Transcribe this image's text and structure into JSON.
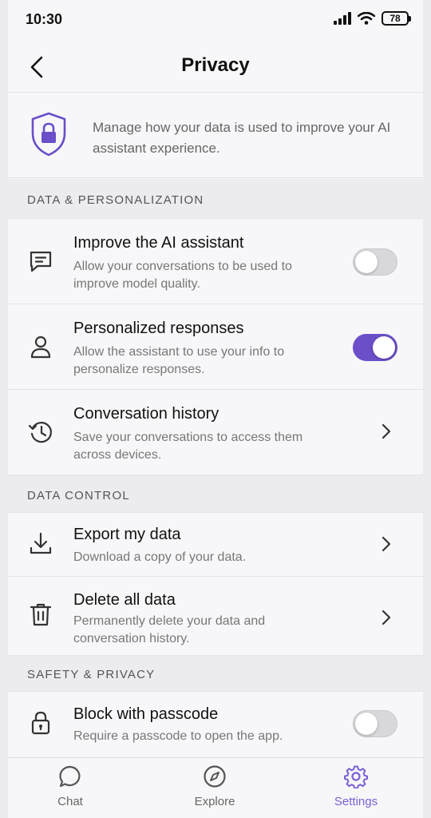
{
  "status_bar": {
    "time": "10:30",
    "battery": "78"
  },
  "header": {
    "title": "Privacy"
  },
  "intro": {
    "text": "Manage how your data is used to improve your AI assistant experience."
  },
  "sections": {
    "data_personalization": {
      "title": "DATA & PERSONALIZATION",
      "items": [
        {
          "title": "Improve the AI assistant",
          "description": "Allow your conversations to be used to improve model quality.",
          "control": "toggle",
          "enabled": false,
          "icon": "chat-bubble-icon"
        },
        {
          "title": "Personalized responses",
          "description": "Allow the assistant to use your info to personalize responses.",
          "control": "toggle",
          "enabled": true,
          "icon": "person-icon"
        },
        {
          "title": "Conversation history",
          "description": "Save your conversations to access them across devices.",
          "control": "chevron",
          "icon": "history-icon"
        }
      ]
    },
    "data_control": {
      "title": "DATA CONTROL",
      "items": [
        {
          "title": "Export my data",
          "description": "Download a copy of your data.",
          "control": "chevron",
          "icon": "download-icon"
        },
        {
          "title": "Delete all data",
          "description": "Permanently delete your data and conversation history.",
          "control": "chevron",
          "icon": "trash-icon"
        }
      ]
    },
    "safety_privacy": {
      "title": "SAFETY & PRIVACY",
      "items": [
        {
          "title": "Block with passcode",
          "description": "Require a passcode to open the app.",
          "control": "toggle",
          "enabled": false,
          "icon": "lock-icon"
        }
      ]
    }
  },
  "tabbar": {
    "items": [
      {
        "label": "Chat",
        "icon": "chat-icon",
        "active": false
      },
      {
        "label": "Explore",
        "icon": "compass-icon",
        "active": false
      },
      {
        "label": "Settings",
        "icon": "gear-icon",
        "active": true
      }
    ]
  },
  "colors": {
    "accent": "#6a4fc8",
    "tab_active": "#7b5fd6",
    "toggle_off": "#d8d8dc"
  }
}
